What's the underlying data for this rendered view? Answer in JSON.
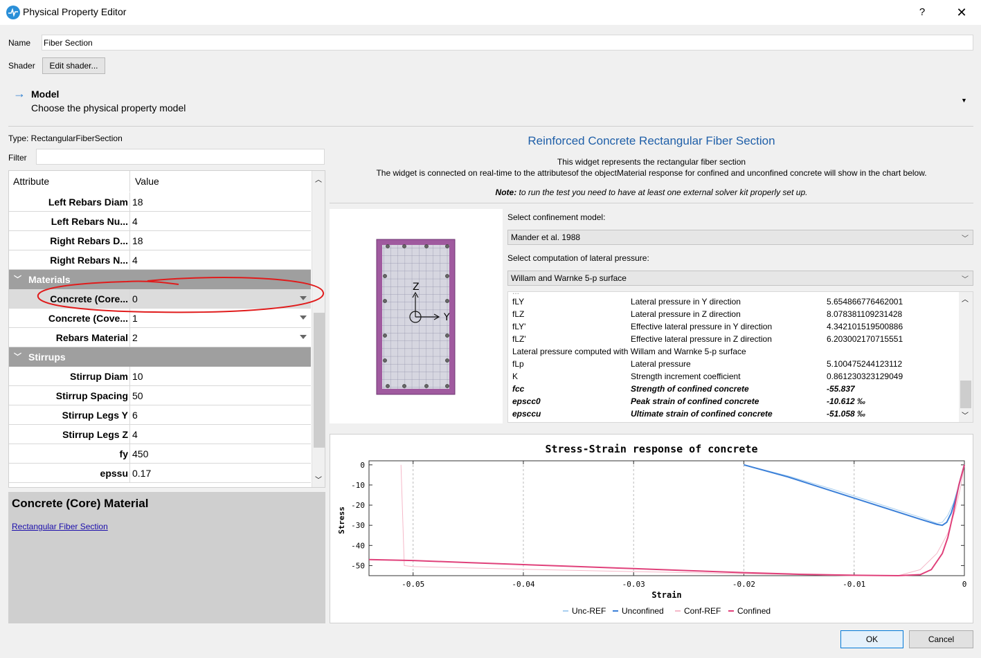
{
  "window": {
    "title": "Physical Property Editor",
    "help": "?",
    "close": "✕"
  },
  "name_label": "Name",
  "name_value": "Fiber Section",
  "shader_label": "Shader",
  "shader_button": "Edit shader...",
  "model": {
    "title": "Model",
    "subtitle": "Choose the physical property model"
  },
  "type_line": "Type:  RectangularFiberSection",
  "filter_label": "Filter",
  "table_headers": {
    "attribute": "Attribute",
    "value": "Value"
  },
  "rows_top": [
    {
      "key": "Left Rebars Diam",
      "value": "18"
    },
    {
      "key": "Left Rebars Nu...",
      "value": "4"
    },
    {
      "key": "Right Rebars D...",
      "value": "18"
    },
    {
      "key": "Right Rebars N...",
      "value": "4"
    }
  ],
  "group_materials": "Materials",
  "rows_materials": [
    {
      "key": "Concrete (Core...",
      "value": "0"
    },
    {
      "key": "Concrete (Cove...",
      "value": "1"
    },
    {
      "key": "Rebars Material",
      "value": "2"
    }
  ],
  "group_stirrups": "Stirrups",
  "rows_stirrups": [
    {
      "key": "Stirrup Diam",
      "value": "10"
    },
    {
      "key": "Stirrup Spacing",
      "value": "50"
    },
    {
      "key": "Stirrup Legs Y",
      "value": "6"
    },
    {
      "key": "Stirrup Legs Z",
      "value": "4"
    },
    {
      "key": "fy",
      "value": "450"
    },
    {
      "key": "epssu",
      "value": "0.17"
    }
  ],
  "info": {
    "title": "Concrete (Core) Material",
    "link": "Rectangular Fiber Section"
  },
  "right": {
    "title": "Reinforced Concrete Rectangular Fiber Section",
    "desc1": "This widget represents the rectangular fiber section",
    "desc2": "The widget is connected on real-time to the attributesof the objectMaterial response for confined and unconfined concrete will show in the chart below.",
    "note_bold": "Note:",
    "note_text": " to run the test you need to have at least one external solver kit properly set up.",
    "axis_z": "Z",
    "axis_y": "Y",
    "conf_label": "Select confinement model:",
    "conf_value": "Mander et al. 1988",
    "lat_label": "Select computation of lateral pressure:",
    "lat_value": "Willam and Warnke 5-p surface"
  },
  "results": [
    {
      "a": "fLY",
      "b": "Lateral pressure in Y direction",
      "c": "5.654866776462001",
      "bold": false
    },
    {
      "a": "fLZ",
      "b": "Lateral pressure in Z direction",
      "c": "8.078381109231428",
      "bold": false
    },
    {
      "a": "fLY'",
      "b": "Effective lateral pressure in Y direction",
      "c": "4.342101519500886",
      "bold": false
    },
    {
      "a": "fLZ'",
      "b": "Effective lateral pressure in Z direction",
      "c": "6.203002170715551",
      "bold": false
    },
    {
      "a": "Lateral pressure computed with Willam and Warnke 5-p surface",
      "b": "",
      "c": "",
      "bold": false
    },
    {
      "a": "fLp",
      "b": "Lateral pressure",
      "c": "5.100475244123112",
      "bold": false
    },
    {
      "a": "K",
      "b": "Strength increment coefficient",
      "c": "0.861230323129049",
      "bold": false
    },
    {
      "a": "fcc",
      "b": "Strength of confined concrete",
      "c": "-55.837",
      "bold": true
    },
    {
      "a": "epscc0",
      "b": "Peak strain of confined concrete",
      "c": "-10.612 ‰",
      "bold": true
    },
    {
      "a": "epsccu",
      "b": "Ultimate strain of confined concrete",
      "c": "-51.058 ‰",
      "bold": true
    }
  ],
  "chart_data": {
    "type": "line",
    "title": "Stress-Strain response of concrete",
    "xlabel": "Strain",
    "ylabel": "Stress",
    "xlim": [
      -0.054,
      0.0
    ],
    "ylim": [
      -55,
      2
    ],
    "xticks": [
      -0.05,
      -0.04,
      -0.03,
      -0.02,
      -0.01,
      0
    ],
    "xtick_labels": [
      "-0.05",
      "-0.04",
      "-0.03",
      "-0.02",
      "-0.01",
      "0"
    ],
    "yticks": [
      0,
      -10,
      -20,
      -30,
      -40,
      -50
    ],
    "ytick_labels": [
      "0",
      "-10",
      "-20",
      "-30",
      "-40",
      "-50"
    ],
    "legend_placement": "bottom",
    "series": [
      {
        "name": "Unc-REF",
        "color": "#a8cff0",
        "width": 1,
        "x": [
          0.0,
          -0.0005,
          -0.001,
          -0.0015,
          -0.002,
          -0.0025,
          -0.004,
          -0.008,
          -0.012,
          -0.016,
          -0.02
        ],
        "y": [
          0,
          -10,
          -19,
          -25,
          -28.5,
          -29,
          -26,
          -19,
          -12,
          -5.5,
          0
        ]
      },
      {
        "name": "Unconfined",
        "color": "#3a7fd8",
        "width": 2,
        "x": [
          0.0,
          -0.0004,
          -0.0008,
          -0.0012,
          -0.0016,
          -0.002,
          -0.0025,
          -0.004,
          -0.008,
          -0.012,
          -0.016,
          -0.02
        ],
        "y": [
          0,
          -8,
          -17,
          -24,
          -28.5,
          -30,
          -29.5,
          -27,
          -20,
          -13,
          -6,
          0
        ]
      },
      {
        "name": "Conf-REF",
        "color": "#f5b8c8",
        "width": 1,
        "x": [
          -0.0511,
          -0.0508,
          -0.05,
          -0.045,
          -0.04,
          -0.03,
          -0.02,
          -0.01,
          -0.006,
          -0.004,
          -0.0025,
          -0.0015,
          -0.0008,
          -0.0003,
          0.0
        ],
        "y": [
          0,
          -50,
          -50.5,
          -51.2,
          -51.8,
          -53,
          -54,
          -55,
          -55.5,
          -52,
          -44,
          -34,
          -22,
          -10,
          0
        ]
      },
      {
        "name": "Confined",
        "color": "#e0407a",
        "width": 2,
        "x": [
          -0.054,
          -0.05,
          -0.045,
          -0.04,
          -0.035,
          -0.03,
          -0.025,
          -0.02,
          -0.015,
          -0.01,
          -0.006,
          -0.004,
          -0.003,
          -0.002,
          -0.0015,
          -0.001,
          -0.0005,
          0.0
        ],
        "y": [
          -47,
          -47.5,
          -48.5,
          -49.5,
          -50.5,
          -51.5,
          -52.5,
          -53.5,
          -54.3,
          -54.8,
          -55,
          -54.5,
          -52,
          -44,
          -36,
          -24,
          -10,
          0
        ]
      }
    ]
  },
  "buttons": {
    "ok": "OK",
    "cancel": "Cancel"
  }
}
